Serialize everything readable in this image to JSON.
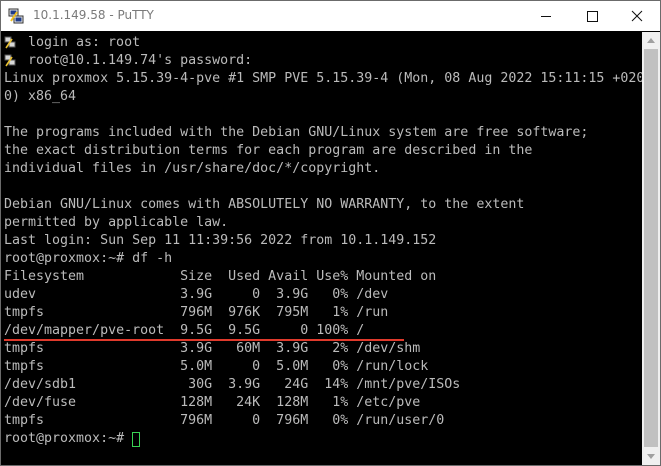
{
  "window": {
    "title": "10.1.149.58 - PuTTY",
    "app_icon": "putty-icon",
    "buttons": [
      "minimize-icon",
      "maximize-icon",
      "close-icon"
    ]
  },
  "terminal": {
    "lines": [
      "login as: root",
      "root@10.1.149.74's password:",
      "Linux proxmox 5.15.39-4-pve #1 SMP PVE 5.15.39-4 (Mon, 08 Aug 2022 15:11:15 +020",
      "0) x86_64",
      "",
      "The programs included with the Debian GNU/Linux system are free software;",
      "the exact distribution terms for each program are described in the",
      "individual files in /usr/share/doc/*/copyright.",
      "",
      "Debian GNU/Linux comes with ABSOLUTELY NO WARRANTY, to the extent",
      "permitted by applicable law.",
      "Last login: Sun Sep 11 11:39:56 2022 from 10.1.149.152",
      "root@proxmox:~# df -h",
      "Filesystem            Size  Used Avail Use% Mounted on",
      "udev                  3.9G     0  3.9G   0% /dev",
      "tmpfs                 796M  976K  795M   1% /run",
      "/dev/mapper/pve-root  9.5G  9.5G     0 100% /",
      "tmpfs                 3.9G   60M  3.9G   2% /dev/shm",
      "tmpfs                 5.0M     0  5.0M   0% /run/lock",
      "/dev/sdb1              30G  3.9G   24G  14% /mnt/pve/ISOs",
      "/dev/fuse             128M   24K  128M   1% /etc/pve",
      "tmpfs                 796M     0  796M   0% /run/user/0",
      "root@proxmox:~# "
    ],
    "key_icon_lines": [
      0,
      1
    ],
    "highlighted_line": 16,
    "highlight_color": "#e03a2c",
    "cursor_color": "#39d353",
    "text_color": "#bbbbbb",
    "background_color": "#000000"
  }
}
